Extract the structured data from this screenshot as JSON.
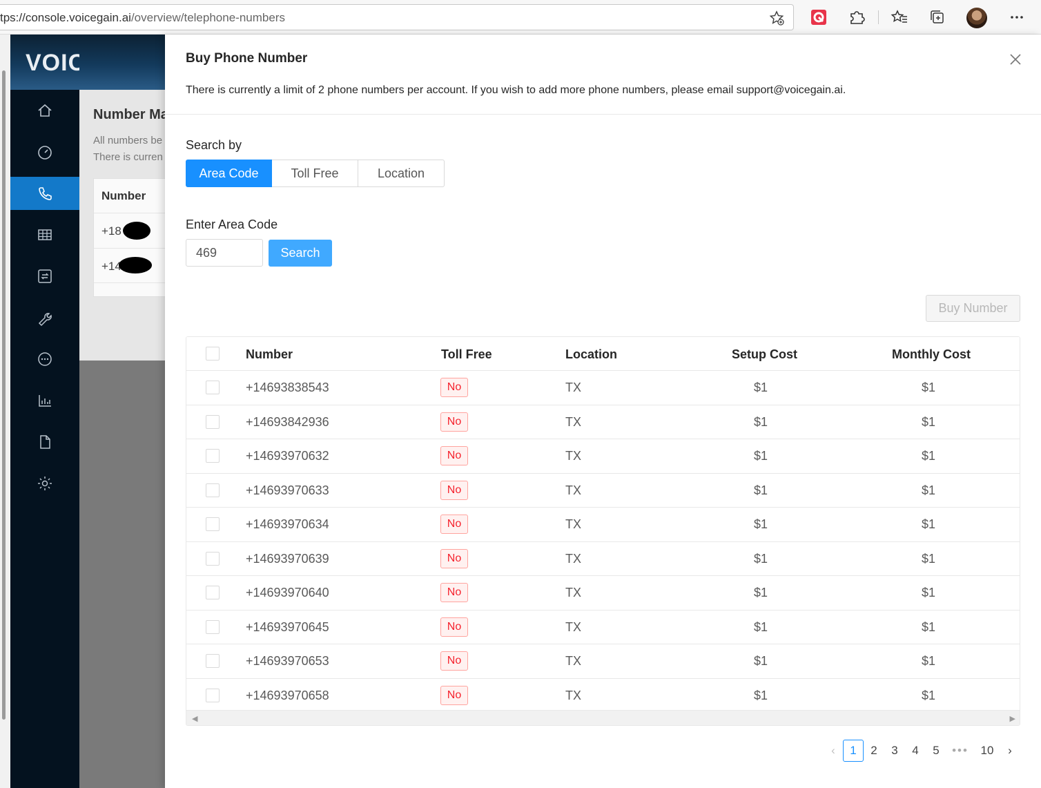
{
  "browser": {
    "url_host": "tps://console.voicegain.ai",
    "url_path": "/overview/telephone-numbers"
  },
  "app": {
    "logo": "VOICEGAI",
    "page_title": "Number Ma",
    "sub1": "All numbers be",
    "sub2": "There is curren",
    "table_header": "Number",
    "row1": "+18      303",
    "row2": "+14      959"
  },
  "drawer": {
    "title": "Buy Phone Number",
    "note": "There is currently a limit of 2 phone numbers per account. If you wish to add more phone numbers, please email support@voicegain.ai.",
    "search_by_label": "Search by",
    "search_modes": [
      "Area Code",
      "Toll Free",
      "Location"
    ],
    "active_mode": "Area Code",
    "area_code_label": "Enter Area Code",
    "area_code_value": "469",
    "search_button": "Search",
    "buy_button": "Buy Number"
  },
  "table": {
    "columns": [
      "Number",
      "Toll Free",
      "Location",
      "Setup Cost",
      "Monthly Cost"
    ],
    "rows": [
      {
        "number": "+14693838543",
        "toll_free": "No",
        "location": "TX",
        "setup": "$1",
        "monthly": "$1"
      },
      {
        "number": "+14693842936",
        "toll_free": "No",
        "location": "TX",
        "setup": "$1",
        "monthly": "$1"
      },
      {
        "number": "+14693970632",
        "toll_free": "No",
        "location": "TX",
        "setup": "$1",
        "monthly": "$1"
      },
      {
        "number": "+14693970633",
        "toll_free": "No",
        "location": "TX",
        "setup": "$1",
        "monthly": "$1"
      },
      {
        "number": "+14693970634",
        "toll_free": "No",
        "location": "TX",
        "setup": "$1",
        "monthly": "$1"
      },
      {
        "number": "+14693970639",
        "toll_free": "No",
        "location": "TX",
        "setup": "$1",
        "monthly": "$1"
      },
      {
        "number": "+14693970640",
        "toll_free": "No",
        "location": "TX",
        "setup": "$1",
        "monthly": "$1"
      },
      {
        "number": "+14693970645",
        "toll_free": "No",
        "location": "TX",
        "setup": "$1",
        "monthly": "$1"
      },
      {
        "number": "+14693970653",
        "toll_free": "No",
        "location": "TX",
        "setup": "$1",
        "monthly": "$1"
      },
      {
        "number": "+14693970658",
        "toll_free": "No",
        "location": "TX",
        "setup": "$1",
        "monthly": "$1"
      }
    ]
  },
  "pagination": {
    "pages": [
      "1",
      "2",
      "3",
      "4",
      "5"
    ],
    "current": "1",
    "ellipsis": "•••",
    "last": "10"
  },
  "colors": {
    "primary": "#1890ff",
    "sidebar": "#04121f",
    "active_nav": "#1379c9",
    "tag_red": "#f5222d"
  },
  "icons": {
    "sidebar": [
      "home-icon",
      "dashboard-icon",
      "phone-icon",
      "table-icon",
      "transfer-icon",
      "wrench-icon",
      "chat-icon",
      "bar-chart-icon",
      "file-icon",
      "gear-icon"
    ],
    "toolbar": [
      "add-favorite-icon",
      "extension-red-icon",
      "puzzle-icon",
      "favorites-icon",
      "collections-icon",
      "profile-avatar",
      "more-icon"
    ]
  }
}
